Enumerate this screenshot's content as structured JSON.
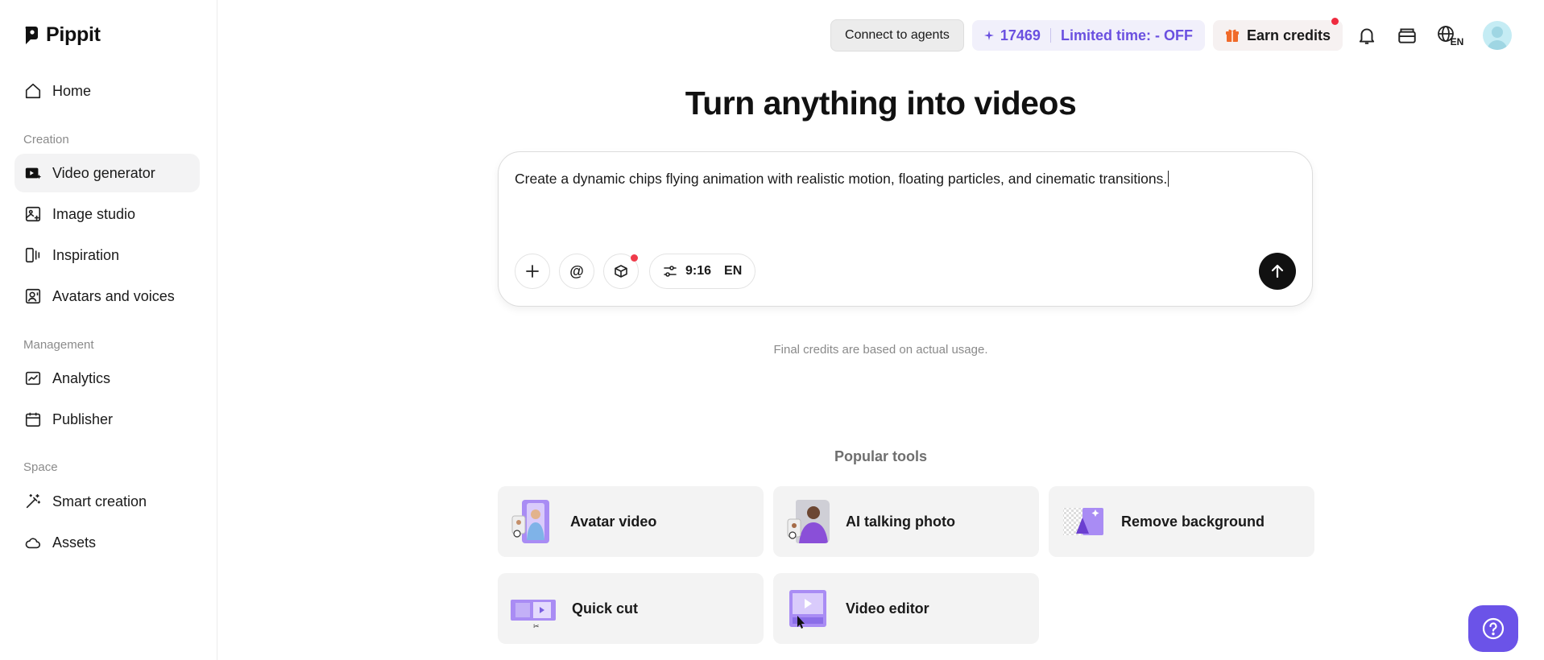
{
  "brand": {
    "name": "Pippit"
  },
  "sidebar": {
    "home": "Home",
    "sections": {
      "creation": "Creation",
      "management": "Management",
      "space": "Space"
    },
    "items": {
      "video_generator": "Video generator",
      "image_studio": "Image studio",
      "inspiration": "Inspiration",
      "avatars_voices": "Avatars and voices",
      "analytics": "Analytics",
      "publisher": "Publisher",
      "smart_creation": "Smart creation",
      "assets": "Assets"
    },
    "active": "video_generator"
  },
  "topbar": {
    "connect_agents": "Connect to agents",
    "credits_value": "17469",
    "limited_time": "Limited time: - OFF",
    "earn_credits": "Earn credits",
    "language": "EN"
  },
  "main": {
    "headline": "Turn anything into videos",
    "prompt_text": "Create a dynamic chips flying animation with realistic motion, floating particles, and cinematic transitions.",
    "aspect_ratio": "9:16",
    "language": "EN",
    "credits_note": "Final credits are based on actual usage.",
    "popular_title": "Popular tools",
    "tools": [
      {
        "label": "Avatar video",
        "icon": "avatar-video-thumb"
      },
      {
        "label": "AI talking photo",
        "icon": "talking-photo-thumb"
      },
      {
        "label": "Remove background",
        "icon": "remove-background-thumb"
      },
      {
        "label": "Quick cut",
        "icon": "quick-cut-thumb"
      },
      {
        "label": "Video editor",
        "icon": "video-editor-thumb"
      }
    ]
  },
  "colors": {
    "accent": "#6b53e8",
    "credits_text": "#6a50e0",
    "notification_dot": "#ef2b3f"
  }
}
